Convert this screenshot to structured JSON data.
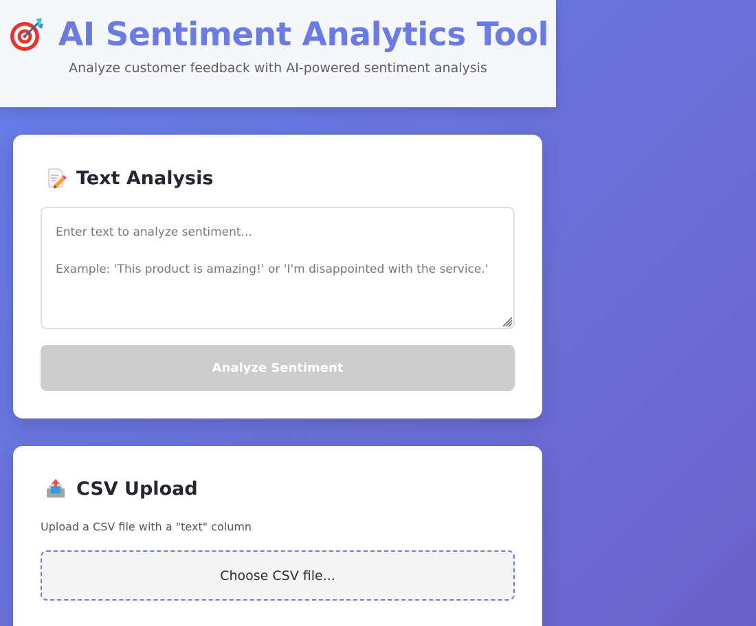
{
  "header": {
    "title": "AI Sentiment Analytics Tool",
    "subtitle": "Analyze customer feedback with AI-powered sentiment analysis",
    "title_icon": "target-dart-icon"
  },
  "text_analysis": {
    "title": "Text Analysis",
    "icon": "memo-pencil-icon",
    "placeholder": "Enter text to analyze sentiment...\n\nExample: 'This product is amazing!' or 'I'm disappointed with the service.'",
    "value": "",
    "button_label": "Analyze Sentiment",
    "button_state": "disabled"
  },
  "csv_upload": {
    "title": "CSV Upload",
    "icon": "inbox-upload-icon",
    "description": "Upload a CSV file with a \"text\" column",
    "file_label": "Choose CSV file..."
  },
  "colors": {
    "accent": "#6a7ce3",
    "background_start": "#667eea",
    "background_end": "#6b61c9",
    "button_disabled": "#cccccc",
    "dart_red": "#e8332f"
  }
}
